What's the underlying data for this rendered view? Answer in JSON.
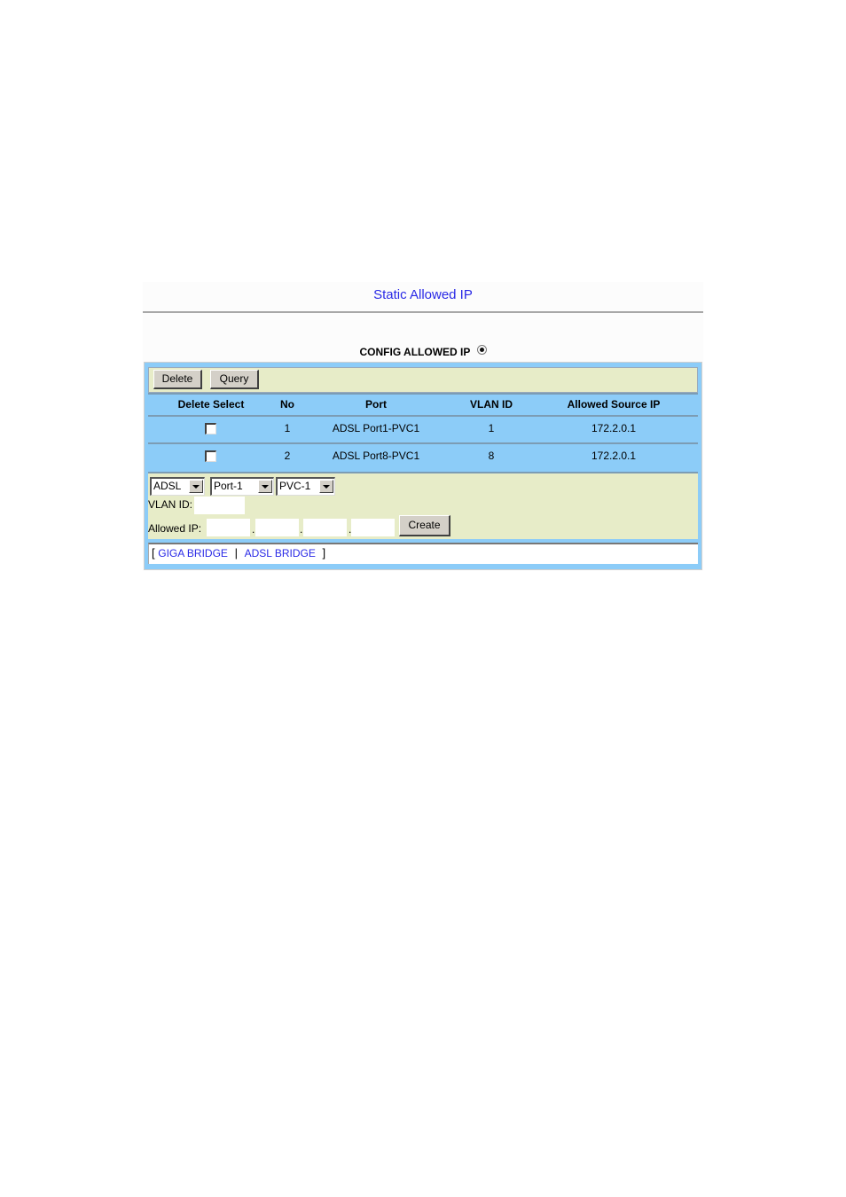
{
  "page": {
    "title": "Static Allowed IP",
    "section_label": "CONFIG ALLOWED IP",
    "section_radio_selected": true
  },
  "toolbar": {
    "delete_label": "Delete",
    "query_label": "Query"
  },
  "table": {
    "columns": [
      "Delete Select",
      "No",
      "Port",
      "VLAN ID",
      "Allowed Source IP"
    ],
    "rows": [
      {
        "selected": false,
        "no": "1",
        "port": "ADSL Port1-PVC1",
        "vlan_id": "1",
        "allowed_ip": "172.2.0.1"
      },
      {
        "selected": false,
        "no": "2",
        "port": "ADSL Port8-PVC1",
        "vlan_id": "8",
        "allowed_ip": "172.2.0.1"
      }
    ]
  },
  "form": {
    "type_select": "ADSL",
    "port_select": "Port-1",
    "pvc_select": "PVC-1",
    "vlan_label": "VLAN ID:",
    "vlan_value": "",
    "ip_label": "Allowed IP:",
    "ip_octets": [
      "",
      "",
      "",
      ""
    ],
    "ip_separator": ".",
    "create_label": "Create"
  },
  "footer": {
    "open_bracket": "[",
    "close_bracket": "]",
    "separator": "|",
    "links": [
      "GIGA BRIDGE",
      "ADSL BRIDGE"
    ]
  }
}
